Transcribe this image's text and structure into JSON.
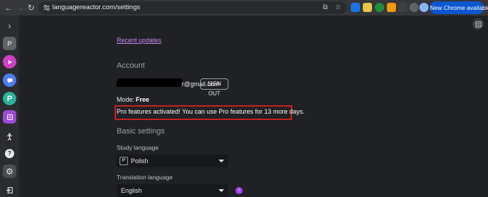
{
  "browser": {
    "url": "languagereactor.com/settings",
    "new_chrome_label": "New Chrome available",
    "more_label": "⋮"
  },
  "sidebar": {
    "collapse": "›",
    "profile_letter": "P",
    "items": [
      {
        "icon": "play-icon",
        "color": "#d33fc4"
      },
      {
        "icon": "chat-icon",
        "color": "#4f7df3"
      },
      {
        "icon": "p-logo-icon",
        "color": "#2bb39a"
      },
      {
        "icon": "list-icon",
        "color": "#9c4ad6"
      },
      {
        "icon": "person-icon",
        "color": "#2b2c2f"
      },
      {
        "icon": "help-icon",
        "color": "#2b2c2f"
      },
      {
        "icon": "gear-icon",
        "color": "#4a4c50"
      },
      {
        "icon": "exit-icon",
        "color": "#2b2c2f"
      }
    ]
  },
  "main": {
    "recent_updates": "Recent updates",
    "account_title": "Account",
    "email_visible": "r@gmail.com",
    "sign_out": "SIGN OUT",
    "mode_label": "Mode:",
    "mode_value": "Free",
    "pro_message": "Pro features activated! You can use Pro features for 13 more days.",
    "basic_title": "Basic settings",
    "study_label": "Study language",
    "study_flag": "P",
    "study_value": "Polish",
    "translation_label": "Translation language",
    "translation_value": "English",
    "info": "i"
  }
}
